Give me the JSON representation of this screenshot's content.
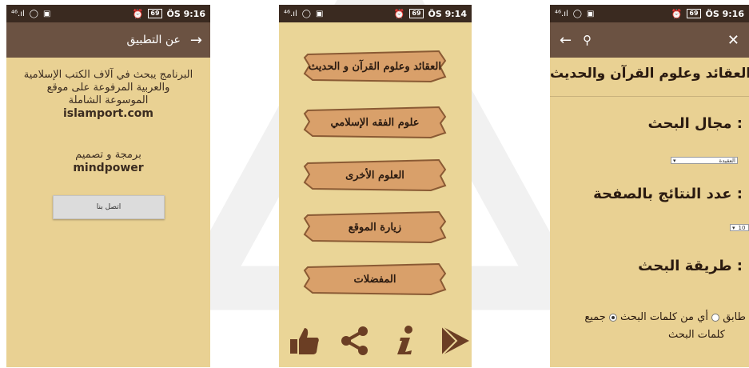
{
  "status": {
    "left": "⁴⁶.ıl",
    "phone1": {
      "battery": "69",
      "time": "ÖS 9:16"
    },
    "phone2": {
      "battery": "69",
      "time": "ÖS 9:14"
    },
    "phone3": {
      "battery": "69",
      "time": "ÖS 9:16"
    }
  },
  "about": {
    "title": "عن التطبيق",
    "desc_line1": "البرنامج يبحث في آلاف الكتب الإسلامية",
    "desc_line2": "والعربية المرفوعة على موقع",
    "desc_line3": "الموسوعة الشاملة",
    "site": "islamport.com",
    "credit_line": "برمجة و تصميم",
    "credit_name": "mindpower",
    "contact_button": "اتصل بنا"
  },
  "menu": {
    "items": [
      "العقائد وعلوم القرآن و الحديث",
      "علوم الفقه الإسلامي",
      "العلوم الأخرى",
      "زيارة الموقع",
      "المفضلات"
    ],
    "icons": [
      "thumbs-up-icon",
      "share-icon",
      "info-icon",
      "play-store-icon"
    ]
  },
  "search": {
    "header": "العقائد وعلوم القرآن والحديث",
    "field_label": "مجال البحث :",
    "field_value": "العقيدة",
    "count_label": "عدد النتائج بالصفحة :",
    "count_value": "10",
    "method_label": "طريقة البحث :",
    "option_match": "طابق",
    "option_any": "أي من كلمات البحث",
    "option_all_line1": "جميع",
    "option_all_line2": "كلمات البحث"
  },
  "colors": {
    "statusbar": "#3a2a20",
    "appbar": "#6b5242",
    "background": "#e9d193",
    "plank": "#d9a06a"
  }
}
